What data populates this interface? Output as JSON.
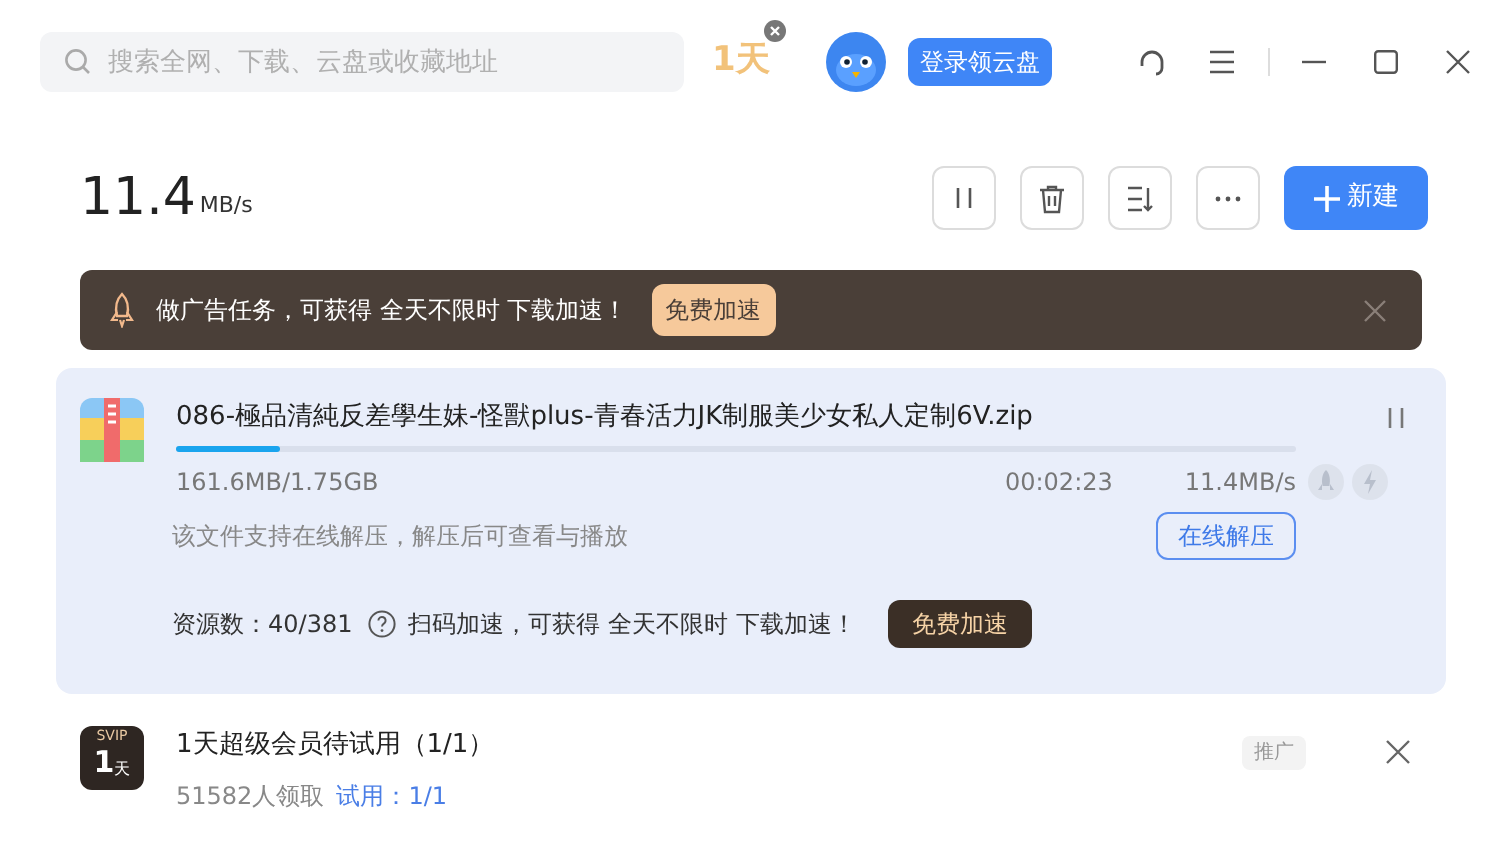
{
  "search": {
    "placeholder": "搜索全网、下载、云盘或收藏地址"
  },
  "trial_badge": "1天",
  "login_button": "登录领云盘",
  "speed": {
    "value": "11.4",
    "unit": "MB/s"
  },
  "new_button": "新建",
  "ad_banner": {
    "text": "做广告任务，可获得 全天不限时 下载加速！",
    "button": "免费加速"
  },
  "task": {
    "name": "086-極品清純反差學生妹-怪獸plus-青春活力JK制服美少女私人定制6V.zip",
    "level": 0.093,
    "size": "161.6MB/1.75GB",
    "time": "00:02:23",
    "speed": "11.4MB/s",
    "hint": "该文件支持在线解压，解压后可查看与播放",
    "unzip_button": "在线解压",
    "resources": "资源数：40/381",
    "scan_text": "扫码加速，可获得 全天不限时 下载加速！",
    "free_button": "免费加速"
  },
  "promo": {
    "badge_top": "SVIP",
    "badge_num": "1",
    "badge_unit": "天",
    "title": "1天超级会员待试用（1/1）",
    "claimed": "51582人领取",
    "trial_link": "试用：1/1",
    "tag": "推广"
  }
}
